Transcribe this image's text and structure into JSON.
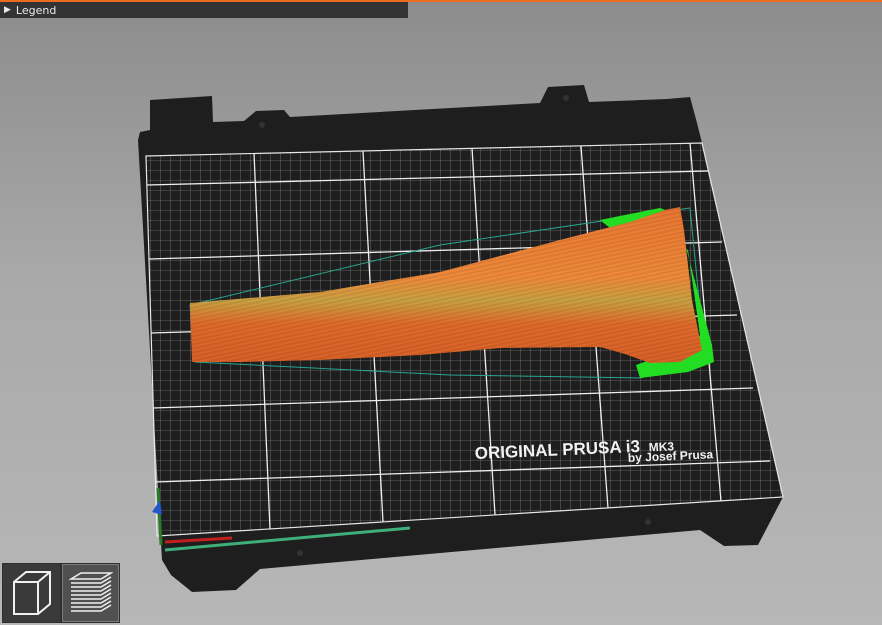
{
  "legend": {
    "label": "Legend",
    "collapsed": true
  },
  "bed": {
    "brand_line": "ORIGINAL PRUSA i3",
    "model": "MK3",
    "byline": "by Josef Prusa"
  },
  "view_buttons": [
    {
      "name": "3D view",
      "icon": "cube-icon",
      "active": false
    },
    {
      "name": "Preview (sliced layers)",
      "icon": "layers-icon",
      "active": true
    }
  ],
  "colors": {
    "accent": "#ed6b21",
    "model_orange": "#e06a2c",
    "support_green": "#22dd22",
    "bed_black": "#1f1f1f",
    "grid_line": "#d8d8d8",
    "travel_line": "#2aa58f"
  }
}
